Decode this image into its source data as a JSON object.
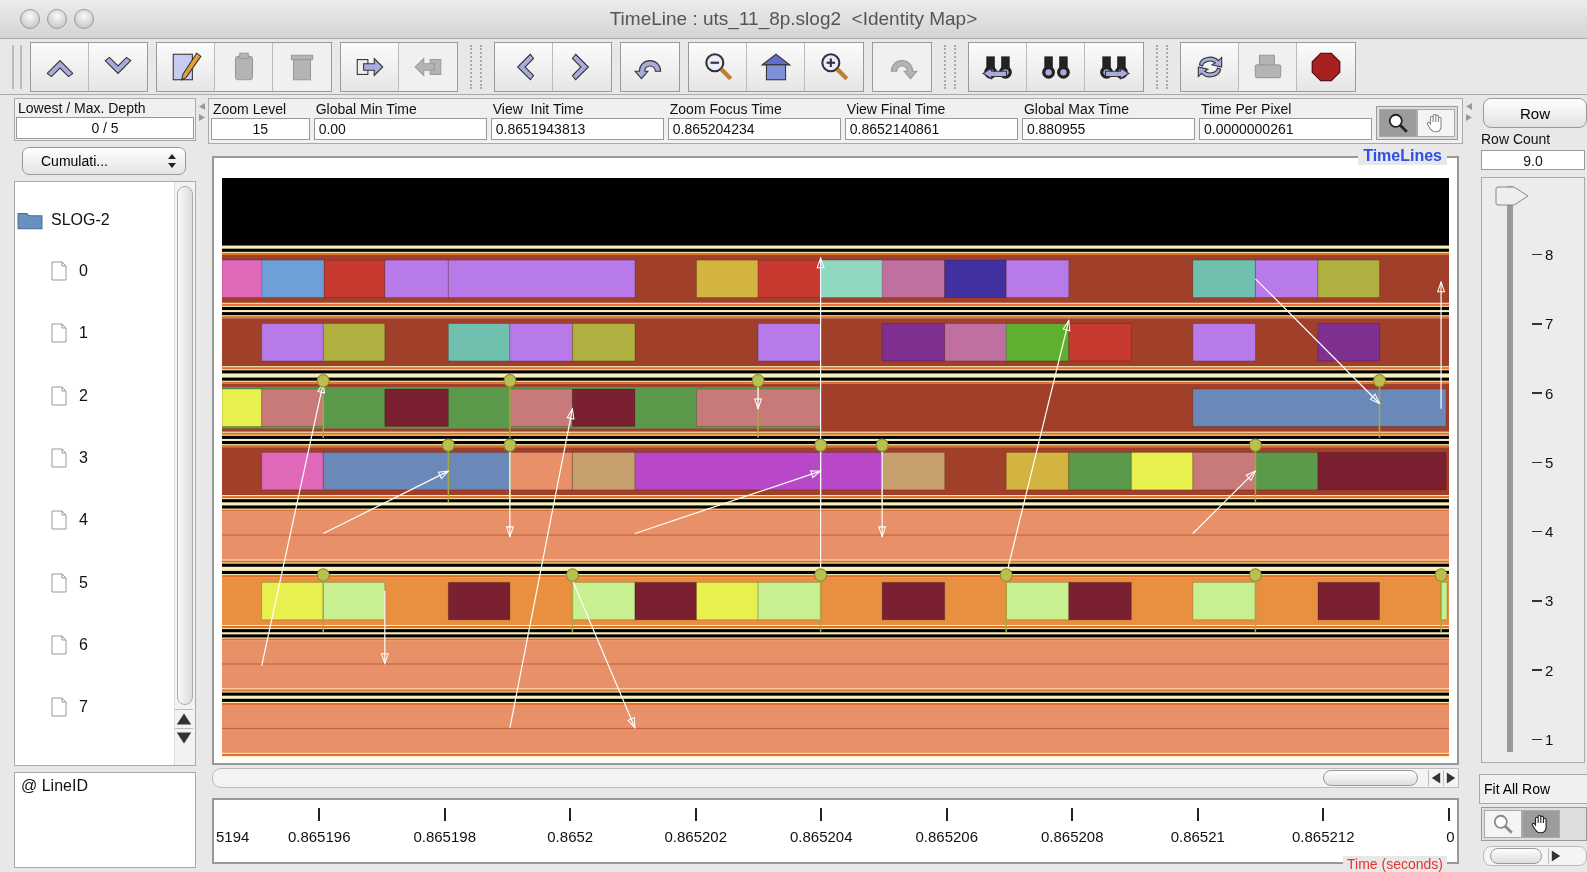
{
  "window": {
    "title": "TimeLine : uts_11_8p.slog2  <Identity Map>"
  },
  "toolbar": [
    {
      "kind": "group",
      "buttons": [
        {
          "kind": "up",
          "disabled": false
        },
        {
          "kind": "down",
          "disabled": false
        }
      ]
    },
    {
      "kind": "group",
      "buttons": [
        {
          "kind": "edit",
          "disabled": false
        },
        {
          "kind": "paste",
          "disabled": true
        },
        {
          "kind": "delete",
          "disabled": true
        }
      ]
    },
    {
      "kind": "group",
      "buttons": [
        {
          "kind": "export",
          "disabled": false
        },
        {
          "kind": "import",
          "disabled": true
        }
      ]
    },
    {
      "kind": "separator"
    },
    {
      "kind": "group",
      "buttons": [
        {
          "kind": "back",
          "disabled": false
        },
        {
          "kind": "forward",
          "disabled": false
        }
      ]
    },
    {
      "kind": "group",
      "buttons": [
        {
          "kind": "undo",
          "disabled": false
        }
      ]
    },
    {
      "kind": "group",
      "buttons": [
        {
          "kind": "zoom-out",
          "disabled": false
        },
        {
          "kind": "home",
          "disabled": false
        },
        {
          "kind": "zoom-in",
          "disabled": false
        }
      ]
    },
    {
      "kind": "group",
      "buttons": [
        {
          "kind": "redo",
          "disabled": true
        }
      ]
    },
    {
      "kind": "separator"
    },
    {
      "kind": "group",
      "buttons": [
        {
          "kind": "search-back",
          "disabled": false
        },
        {
          "kind": "search",
          "disabled": false
        },
        {
          "kind": "search-forward",
          "disabled": false
        }
      ]
    },
    {
      "kind": "separator"
    },
    {
      "kind": "group",
      "buttons": [
        {
          "kind": "refresh",
          "disabled": false
        },
        {
          "kind": "print",
          "disabled": true
        },
        {
          "kind": "stop",
          "disabled": false
        }
      ]
    }
  ],
  "depth": {
    "label": "Lowest / Max. Depth",
    "value": "0 / 5"
  },
  "view_mode": {
    "value": "Cumulati..."
  },
  "tree": {
    "label": "SLOG-2",
    "children": [
      {
        "label": "0"
      },
      {
        "label": "1"
      },
      {
        "label": "2"
      },
      {
        "label": "3"
      },
      {
        "label": "4"
      },
      {
        "label": "5"
      },
      {
        "label": "6"
      },
      {
        "label": "7"
      }
    ]
  },
  "line_id": {
    "label": "@ LineID"
  },
  "fields": [
    {
      "label": "Zoom Level",
      "value": "15"
    },
    {
      "label": "Global Min Time",
      "value": "0.00"
    },
    {
      "label": "View  Init Time",
      "value": "0.8651943813"
    },
    {
      "label": "Zoom Focus Time",
      "value": "0.865204234"
    },
    {
      "label": "View Final Time",
      "value": "0.8652140861"
    },
    {
      "label": "Global Max Time",
      "value": "0.880955"
    },
    {
      "label": "Time Per Pixel",
      "value": "0.0000000261"
    }
  ],
  "mode_toggle": [
    {
      "kind": "zoom",
      "selected": true
    },
    {
      "kind": "hand",
      "selected": false
    }
  ],
  "timelines": {
    "title": "TimeLines"
  },
  "axis": {
    "tick_labels": [
      "5194",
      "0.865196",
      "0.865198",
      "0.8652",
      "0.865202",
      "0.865204",
      "0.865206",
      "0.865208",
      "0.86521",
      "0.865212",
      "0"
    ],
    "title": "Time (seconds)"
  },
  "right_panel": {
    "row_button": "Row",
    "row_count_label": "Row Count",
    "row_count": "9.0",
    "slider": {
      "level": 1,
      "tick_labels": [
        "8",
        "7",
        "6",
        "5",
        "4",
        "3",
        "2",
        "1"
      ]
    },
    "fit_button": "Fit All Row",
    "mode_toggle": [
      {
        "kind": "zoom",
        "selected": false
      },
      {
        "kind": "hand",
        "selected": true
      }
    ]
  }
}
